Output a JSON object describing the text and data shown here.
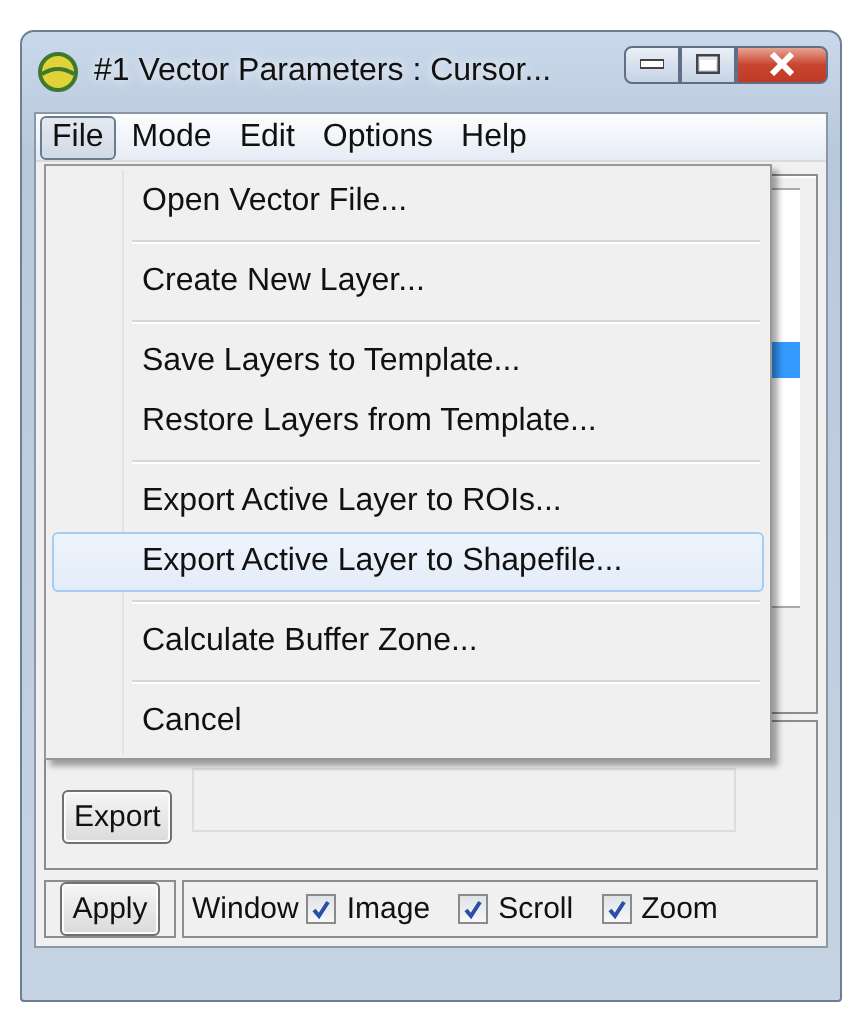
{
  "window": {
    "title": "#1 Vector Parameters : Cursor..."
  },
  "menu_bar": [
    {
      "label": "File",
      "selected": true
    },
    {
      "label": "Mode",
      "selected": false
    },
    {
      "label": "Edit",
      "selected": false
    },
    {
      "label": "Options",
      "selected": false
    },
    {
      "label": "Help",
      "selected": false
    }
  ],
  "file_menu": {
    "groups": [
      [
        {
          "label": "Open Vector File...",
          "selected": false
        }
      ],
      [
        {
          "label": "Create New Layer...",
          "selected": false
        }
      ],
      [
        {
          "label": "Save Layers to Template...",
          "selected": false
        },
        {
          "label": "Restore Layers from Template...",
          "selected": false
        }
      ],
      [
        {
          "label": "Export Active Layer to ROIs...",
          "selected": false
        },
        {
          "label": "Export Active Layer to Shapefile...",
          "selected": true
        }
      ],
      [
        {
          "label": "Calculate Buffer Zone...",
          "selected": false
        }
      ],
      [
        {
          "label": "Cancel",
          "selected": false
        }
      ]
    ]
  },
  "location": {
    "button": "Export"
  },
  "bottom": {
    "button": "Apply",
    "window_label": "Window",
    "checkboxes": [
      {
        "label": "Image",
        "checked": true
      },
      {
        "label": "Scroll",
        "checked": true
      },
      {
        "label": "Zoom",
        "checked": true
      }
    ]
  }
}
